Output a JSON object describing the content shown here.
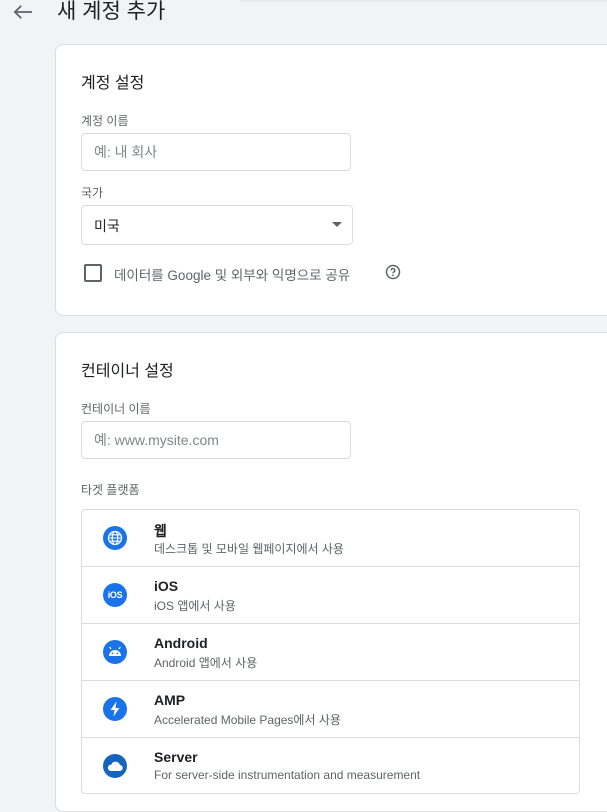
{
  "header": {
    "title": "새 계정 추가"
  },
  "account": {
    "section_title": "계정 설정",
    "name_label": "계정 이름",
    "name_placeholder": "예: 내 회사",
    "country_label": "국가",
    "country_value": "미국",
    "share_label": "데이터를 Google 및 외부와 익명으로 공유"
  },
  "container": {
    "section_title": "컨테이너 설정",
    "name_label": "컨테이너 이름",
    "name_placeholder": "예: www.mysite.com",
    "platform_label": "타겟 플랫폼",
    "platforms": [
      {
        "name": "웹",
        "desc": "데스크톱 및 모바일 웹페이지에서 사용",
        "icon": "globe-icon"
      },
      {
        "name": "iOS",
        "desc": "iOS 앱에서 사용",
        "icon": "ios-icon"
      },
      {
        "name": "Android",
        "desc": "Android 앱에서 사용",
        "icon": "android-icon"
      },
      {
        "name": "AMP",
        "desc": "Accelerated Mobile Pages에서 사용",
        "icon": "amp-bolt-icon"
      },
      {
        "name": "Server",
        "desc": "For server-side instrumentation and measurement",
        "icon": "cloud-icon"
      }
    ]
  },
  "icon_labels": {
    "ios": "iOS"
  },
  "colors": {
    "accent": "#1a73e8",
    "background": "#f1f3f4",
    "border": "#dadce0"
  }
}
